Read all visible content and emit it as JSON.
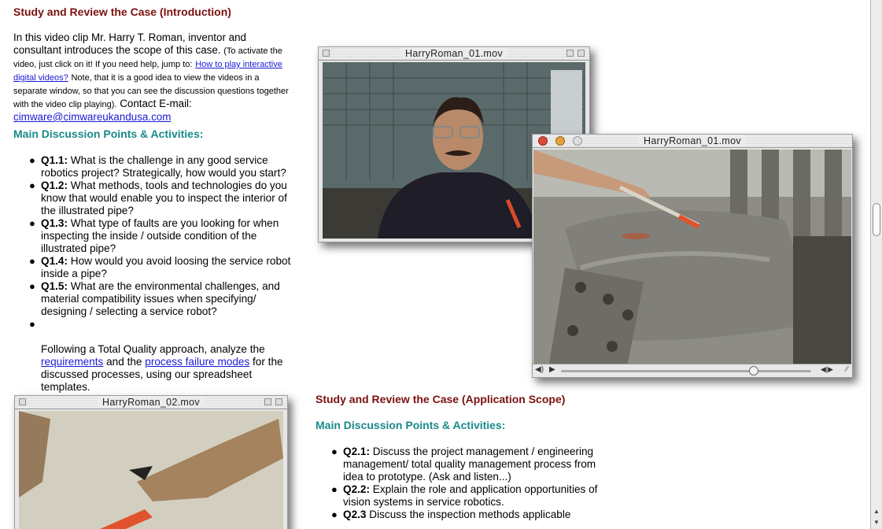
{
  "intro": {
    "heading": "Study and Review the Case (Introduction)",
    "text_a": "In this video clip Mr. Harry T. Roman, inventor and consultant introduces the scope of this case.",
    "note_a": "(To activate the video, just click on it! If you need help, jump to:",
    "link_help": "How to play interactive digital videos?",
    "note_b": "Note, that it is a good idea to view the videos in a separate window, so that you can see the discussion questions together with the video clip playing).",
    "contact_prefix": "Contact E-mail:",
    "email": "cimware@cimwareukandusa.com"
  },
  "section1": {
    "heading": "Main Discussion Points & Activities:",
    "items": [
      {
        "label": "Q1.1:",
        "text": "What is the challenge in any good service robotics project? Strategically, how would you start?"
      },
      {
        "label": "Q1.2:",
        "text": "What methods, tools and technologies do you know that would enable you to inspect the interior of the illustrated pipe?"
      },
      {
        "label": "Q1.3:",
        "text": "What type of faults are you looking for when inspecting the inside / outside condition of the illustrated pipe?"
      },
      {
        "label": "Q1.4:",
        "text": "How would you avoid loosing the service robot inside a pipe?"
      },
      {
        "label": "Q1.5:",
        "text": "What are the environmental challenges, and material compatibility issues when specifying/ designing / selecting a service robot?"
      }
    ],
    "after_text_a": "Following a Total Quality approach, analyze the",
    "link_requirements": "requirements",
    "and": "and the",
    "link_failure": "process failure modes",
    "after_text_b": "for the discussed processes, using our spreadsheet templates."
  },
  "section2": {
    "heading": "Study and Review the Case (Application Scope)",
    "subheading": "Main Discussion Points & Activities:",
    "items": [
      {
        "label": "Q2.1:",
        "text": "Discuss the project management / engineering management/ total quality management process from idea to prototype. (Ask and listen...)"
      },
      {
        "label": "Q2.2:",
        "text": "Explain the role and application opportunities of vision systems in service robotics."
      },
      {
        "label": "Q2.3",
        "text": "Discuss the inspection methods applicable"
      }
    ]
  },
  "videos": {
    "win1_title": "HarryRoman_01.mov",
    "win2_title": "HarryRoman_01.mov",
    "win3_title": "HarryRoman_02.mov",
    "win2_progress": 0.77
  }
}
